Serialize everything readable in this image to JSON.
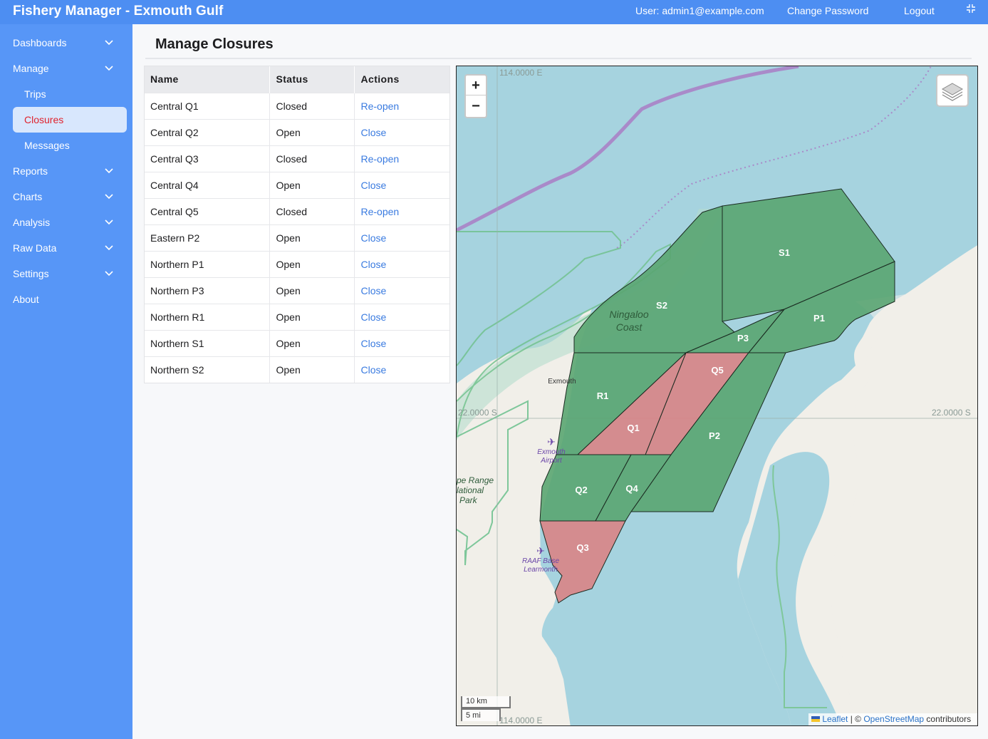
{
  "app": {
    "title": "Fishery Manager - Exmouth Gulf",
    "user": "User: admin1@example.com",
    "change_password": "Change Password",
    "logout": "Logout"
  },
  "sidebar": {
    "items": [
      {
        "label": "Dashboards",
        "expandable": true
      },
      {
        "label": "Manage",
        "expandable": true
      },
      {
        "label": "Trips",
        "sub": true
      },
      {
        "label": "Closures",
        "sub": true,
        "active": true
      },
      {
        "label": "Messages",
        "sub": true
      },
      {
        "label": "Reports",
        "expandable": true
      },
      {
        "label": "Charts",
        "expandable": true
      },
      {
        "label": "Analysis",
        "expandable": true
      },
      {
        "label": "Raw Data",
        "expandable": true
      },
      {
        "label": "Settings",
        "expandable": true
      },
      {
        "label": "About",
        "expandable": false
      }
    ]
  },
  "page": {
    "title": "Manage Closures"
  },
  "table": {
    "headers": [
      "Name",
      "Status",
      "Actions"
    ],
    "rows": [
      {
        "name": "Central Q1",
        "status": "Closed",
        "action": "Re-open"
      },
      {
        "name": "Central Q2",
        "status": "Open",
        "action": "Close"
      },
      {
        "name": "Central Q3",
        "status": "Closed",
        "action": "Re-open"
      },
      {
        "name": "Central Q4",
        "status": "Open",
        "action": "Close"
      },
      {
        "name": "Central Q5",
        "status": "Closed",
        "action": "Re-open"
      },
      {
        "name": "Eastern P2",
        "status": "Open",
        "action": "Close"
      },
      {
        "name": "Northern P1",
        "status": "Open",
        "action": "Close"
      },
      {
        "name": "Northern P3",
        "status": "Open",
        "action": "Close"
      },
      {
        "name": "Northern R1",
        "status": "Open",
        "action": "Close"
      },
      {
        "name": "Northern S1",
        "status": "Open",
        "action": "Close"
      },
      {
        "name": "Northern S2",
        "status": "Open",
        "action": "Close"
      }
    ]
  },
  "map": {
    "zoom_in": "+",
    "zoom_out": "−",
    "grid_lon_top": "114.0000 E",
    "grid_lon_bottom": "114.0000 E",
    "grid_lat_left": "22.0000 S",
    "grid_lat_right": "22.0000 S",
    "scale_km": "10 km",
    "scale_mi": "5 mi",
    "attribution": {
      "leaflet": "Leaflet",
      "separator": " | © ",
      "osm": "OpenStreetMap",
      "suffix": " contributors"
    },
    "place_labels": {
      "ningaloo_1": "Ningaloo",
      "ningaloo_2": "Coast",
      "exmouth": "Exmouth",
      "airport_1": "Exmouth",
      "airport_2": "Airport",
      "range_1": "pe Range",
      "range_2": "lational",
      "range_3": "Park",
      "raaf_1": "RAAF Base",
      "raaf_2": "Learmonth"
    },
    "zones": [
      {
        "label": "S1",
        "status": "open"
      },
      {
        "label": "S2",
        "status": "open"
      },
      {
        "label": "P1",
        "status": "open"
      },
      {
        "label": "P3",
        "status": "open"
      },
      {
        "label": "Q5",
        "status": "closed"
      },
      {
        "label": "R1",
        "status": "open"
      },
      {
        "label": "Q1",
        "status": "closed"
      },
      {
        "label": "P2",
        "status": "open"
      },
      {
        "label": "Q2",
        "status": "open"
      },
      {
        "label": "Q4",
        "status": "open"
      },
      {
        "label": "Q3",
        "status": "closed"
      }
    ],
    "colors": {
      "water": "#a6d3df",
      "land": "#f1efe9",
      "open_zone": "#5aa571",
      "closed_zone": "#d98486",
      "boundary_purple": "#a98ac9"
    }
  }
}
